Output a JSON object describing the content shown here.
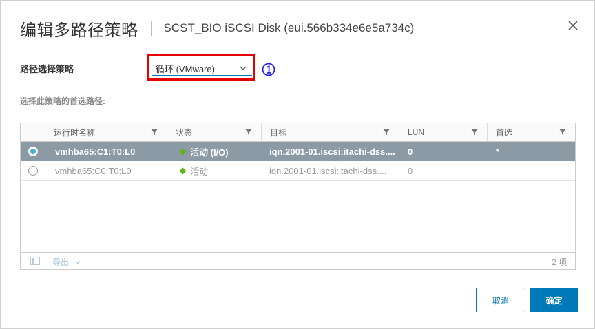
{
  "dialog": {
    "title": "编辑多路径策略",
    "subtitle": "SCST_BIO iSCSI Disk (eui.566b334e6e5a734c)"
  },
  "policy": {
    "label": "路径选择策略",
    "value": "循环 (VMware)"
  },
  "preferred_label": "选择此策略的首选路径:",
  "grid": {
    "columns": [
      "运行时名称",
      "状态",
      "目标",
      "LUN",
      "首选"
    ],
    "rows": [
      {
        "runtime": "vmhba65:C1:T0:L0",
        "status": "活动 (I/O)",
        "target": "iqn.2001-01.iscsi:itachi-dss....",
        "lun": "0",
        "preferred": "*",
        "selected": true
      },
      {
        "runtime": "vmhba65:C0:T0:L0",
        "status": "活动",
        "target": "iqn.2001-01.iscsi:itachi-dss....",
        "lun": "0",
        "preferred": "",
        "selected": false
      }
    ],
    "footer": {
      "export_label": "导出",
      "count": "2 项"
    }
  },
  "buttons": {
    "cancel": "取消",
    "ok": "确定"
  },
  "colors": {
    "accent": "#0079b8",
    "highlight_box": "#e60000",
    "selected_row": "#8c9aa6",
    "status_green": "#60b515"
  },
  "icons": [
    "close-icon",
    "chevron-down-icon",
    "circled-number-one-icon",
    "filter-icon",
    "column-toggle-icon",
    "status-diamond-icon"
  ]
}
